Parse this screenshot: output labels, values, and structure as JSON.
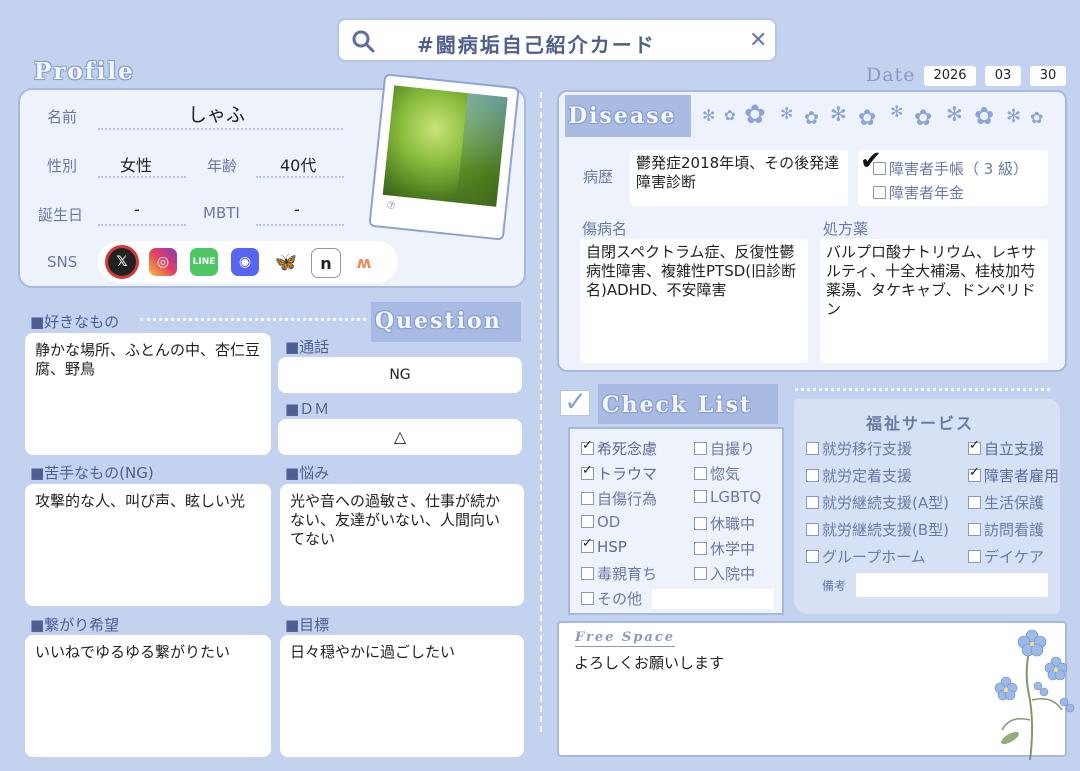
{
  "search": {
    "text": "#闘病垢自己紹介カード"
  },
  "date": {
    "label": "Date",
    "year": "2026",
    "month": "03",
    "day": "30"
  },
  "profile": {
    "title": "Profile",
    "name_label": "名前",
    "name": "しゃふ",
    "gender_label": "性別",
    "gender": "女性",
    "age_label": "年齢",
    "age": "40代",
    "birthday_label": "誕生日",
    "birthday": "-",
    "mbti_label": "MBTI",
    "mbti": "-",
    "sns_label": "SNS",
    "photo_caption": "⑦"
  },
  "question": {
    "title": "Question",
    "likes_label": "■好きなもの",
    "likes": "静かな場所、ふとんの中、杏仁豆腐、野鳥",
    "call_label": "■通話",
    "call": "NG",
    "dm_label": "■ＤＭ",
    "dm": "△",
    "dislikes_label": "■苦手なもの(NG)",
    "dislikes": "攻撃的な人、叫び声、眩しい光",
    "worries_label": "■悩み",
    "worries": "光や音への過敏さ、仕事が続かない、友達がいない、人間向いてない",
    "connect_label": "■繋がり希望",
    "connect": "いいねでゆるゆる繋がりたい",
    "goal_label": "■目標",
    "goal": "日々穏やかに過ごしたい"
  },
  "disease": {
    "title": "Disease",
    "history_label": "病歴",
    "history": "鬱発症2018年頃、その後発達障害診断",
    "techo_label": "障害者手帳（ 3 級）",
    "pension_label": "障害者年金",
    "diagnosis_label": "傷病名",
    "diagnosis": "自閉スペクトラム症、反復性鬱病性障害、複雑性PTSD(旧診断名)ADHD、不安障害",
    "meds_label": "処方薬",
    "meds": "バルプロ酸ナトリウム、レキサルティ、十全大補湯、桂枝加芍薬湯、タケキャブ、ドンペリドン"
  },
  "checklist": {
    "title": "Check List",
    "left": [
      {
        "label": "希死念慮",
        "checked": true
      },
      {
        "label": "トラウマ",
        "checked": true
      },
      {
        "label": "自傷行為",
        "checked": false
      },
      {
        "label": "OD",
        "checked": false
      },
      {
        "label": "HSP",
        "checked": true
      },
      {
        "label": "毒親育ち",
        "checked": false
      },
      {
        "label": "その他",
        "checked": false
      }
    ],
    "right": [
      {
        "label": "自撮り",
        "checked": false
      },
      {
        "label": "惚気",
        "checked": false
      },
      {
        "label": "LGBTQ",
        "checked": false
      },
      {
        "label": "休職中",
        "checked": false
      },
      {
        "label": "休学中",
        "checked": false
      },
      {
        "label": "入院中",
        "checked": false
      }
    ]
  },
  "welfare": {
    "title": "福祉サービス",
    "left": [
      {
        "label": "就労移行支援",
        "checked": false
      },
      {
        "label": "就労定着支援",
        "checked": false
      },
      {
        "label": "就労継続支援(A型)",
        "checked": false
      },
      {
        "label": "就労継続支援(B型)",
        "checked": false
      },
      {
        "label": "グループホーム",
        "checked": false
      }
    ],
    "right": [
      {
        "label": "自立支援",
        "checked": true
      },
      {
        "label": "障害者雇用",
        "checked": true
      },
      {
        "label": "生活保護",
        "checked": false
      },
      {
        "label": "訪問看護",
        "checked": false
      },
      {
        "label": "デイケア",
        "checked": false
      }
    ],
    "note_label": "備考"
  },
  "free": {
    "title": "Free Space",
    "text": "よろしくお願いします"
  }
}
